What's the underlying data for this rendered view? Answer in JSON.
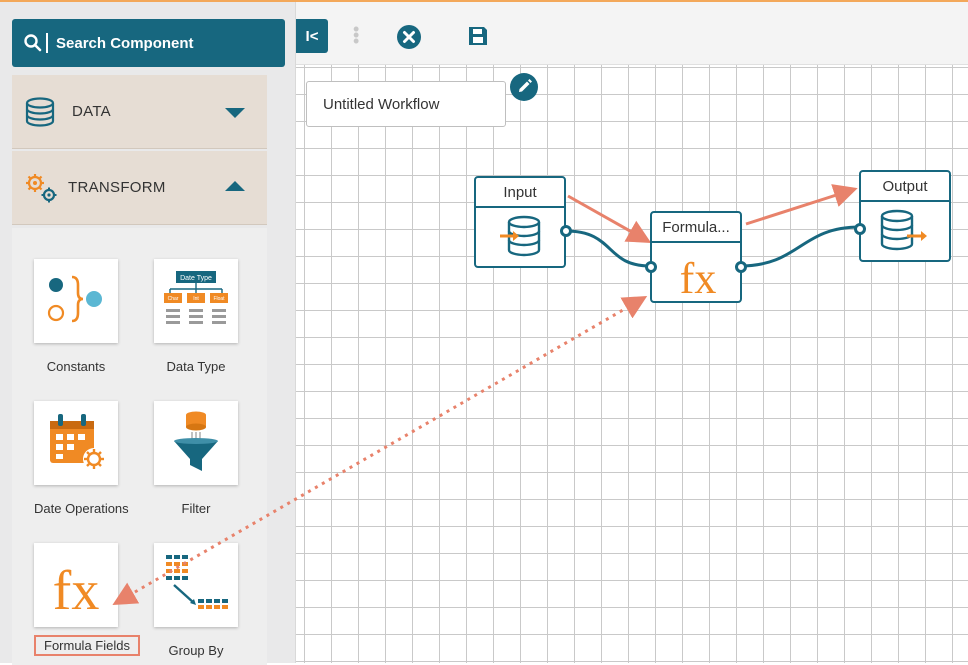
{
  "sidebar": {
    "search_label": "Search Component",
    "categories": [
      {
        "label": "DATA",
        "icon": "database-icon",
        "expanded": false
      },
      {
        "label": "TRANSFORM",
        "icon": "gears-icon",
        "expanded": true
      }
    ],
    "components": [
      {
        "label": "Constants",
        "icon": "constants-icon"
      },
      {
        "label": "Data Type",
        "icon": "data-type-icon",
        "icon_caption": "Date Type",
        "icon_cells": [
          "Char",
          "Int",
          "Float"
        ]
      },
      {
        "label": "Date Operations",
        "icon": "calendar-gear-icon"
      },
      {
        "label": "Filter",
        "icon": "funnel-icon"
      },
      {
        "label": "Formula Fields",
        "icon": "fx-icon",
        "icon_text": "fx"
      },
      {
        "label": "Group By",
        "icon": "group-by-icon"
      }
    ]
  },
  "toolbar": {
    "collapse_label": "I<",
    "actions": [
      "close-icon",
      "save-icon"
    ]
  },
  "workflow": {
    "title": "Untitled Workflow",
    "nodes": [
      {
        "label": "Input",
        "icon": "database-in-icon"
      },
      {
        "label": "Formula...",
        "icon": "fx-icon",
        "icon_text": "fx"
      },
      {
        "label": "Output",
        "icon": "database-out-icon"
      }
    ]
  },
  "colors": {
    "primary": "#17677f",
    "accent_orange": "#f08a24",
    "annotation": "#e8826b",
    "category_bg": "#e6ddd4",
    "sidebar_bg": "#e9e9ea"
  }
}
